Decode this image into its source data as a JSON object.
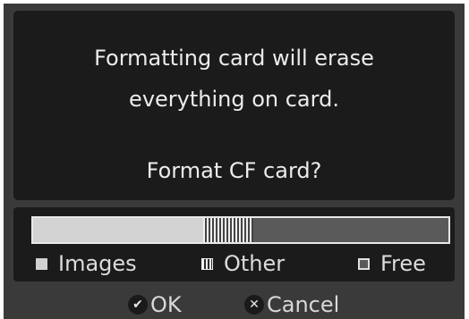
{
  "dialog": {
    "message_line1": "Formatting card will erase",
    "message_line2": "everything on card.",
    "question": "Format CF card?"
  },
  "storage": {
    "images_fraction": 0.41,
    "other_fraction": 0.12,
    "free_fraction": 0.47,
    "legend": {
      "images": "Images",
      "other": "Other",
      "free": "Free"
    }
  },
  "softkeys": {
    "ok": {
      "icon": "check-icon",
      "glyph": "✔",
      "label": "OK"
    },
    "cancel": {
      "icon": "close-icon",
      "glyph": "✕",
      "label": "Cancel"
    }
  },
  "colors": {
    "screen_bg": "#3a3a3a",
    "panel_bg": "#1b1b1b",
    "text": "#ececec"
  }
}
